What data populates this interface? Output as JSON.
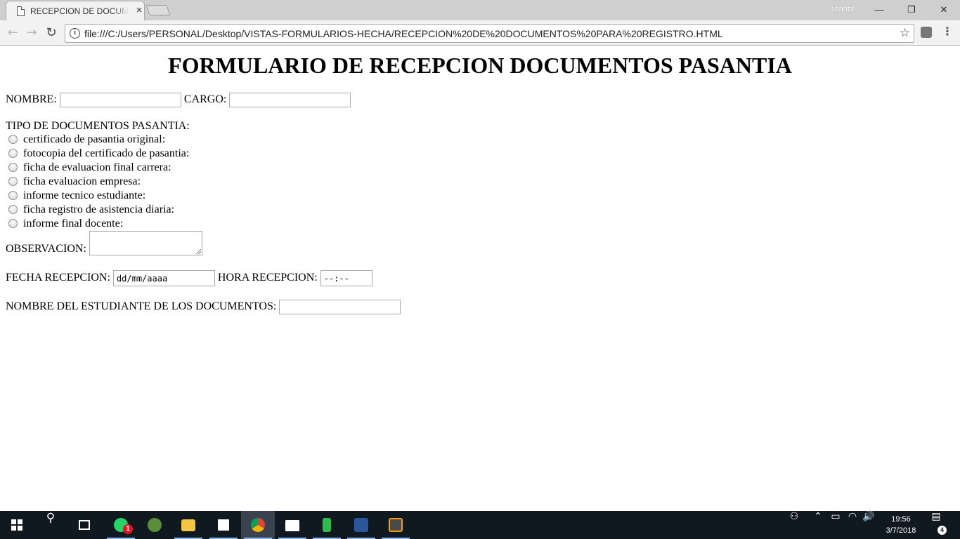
{
  "browser": {
    "tab_title": "RECEPCION DE DOCUMENTOS PARA REGISTRO",
    "tab_close": "×",
    "user_name": "shantal",
    "minimize": "—",
    "restore": "❐",
    "close": "✕",
    "back": "←",
    "forward": "→",
    "reload": "↻",
    "address": "file:///C:/Users/PERSONAL/Desktop/VISTAS-FORMULARIOS-HECHA/RECEPCION%20DE%20DOCUMENTOS%20PARA%20REGISTRO.HTML",
    "info": "i",
    "bookmark_star": "☆",
    "menu": "⋮"
  },
  "form": {
    "title": "FORMULARIO DE RECEPCION DOCUMENTOS PASANTIA",
    "nombre_label": "NOMBRE:",
    "cargo_label": "CARGO:",
    "tipo_label": "TIPO DE DOCUMENTOS PASANTIA:",
    "documentos": [
      "certificado de pasantia original:",
      "fotocopia del certificado de pasantia:",
      "ficha de evaluacion final carrera:",
      "ficha evaluacion empresa:",
      "informe tecnico estudiante:",
      "ficha registro de asistencia diaria:",
      "informe final docente:"
    ],
    "observacion_label": "OBSERVACION:",
    "fecha_label": "FECHA RECEPCION:",
    "fecha_placeholder": "dd/mm/aaaa",
    "hora_label": "HORA RECEPCION:",
    "hora_placeholder": "--:--",
    "estudiante_label": "NOMBRE DEL ESTUDIANTE DE LOS DOCUMENTOS:"
  },
  "taskbar": {
    "whatsapp_badge": "1",
    "time": "19:56",
    "date": "3/7/2018",
    "notifications": "4",
    "search_glyph": "⚲",
    "volume_glyph": "🔊",
    "chevron_glyph": "⌃"
  },
  "colors": {
    "taskbar_bg": "#101820",
    "whatsapp": "#25d366",
    "chrome_red": "#db4437",
    "word_blue": "#2b579a",
    "explorer_yellow": "#f4c542"
  }
}
